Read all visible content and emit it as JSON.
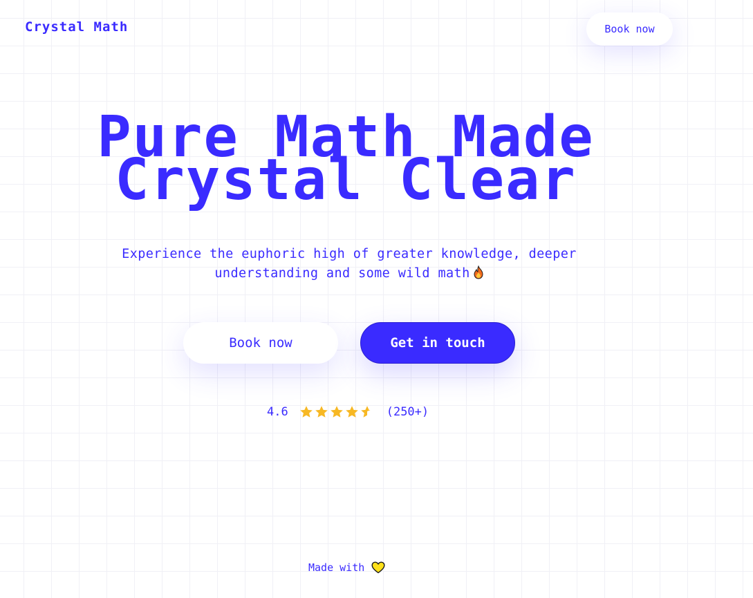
{
  "header": {
    "logo": "Crystal Math",
    "book_label": "Book now"
  },
  "hero": {
    "title_line1": "Pure Math Made",
    "title_line2": "Crystal Clear",
    "subtitle_line1": "Experience the euphoric high of greater knowledge, deeper",
    "subtitle_line2": "understanding and some wild math",
    "subtitle_icon": "fire-icon"
  },
  "actions": {
    "book_label": "Book now",
    "contact_label": "Get in touch"
  },
  "rating": {
    "score": "4.6",
    "stars": 4.6,
    "max_stars": 5,
    "count": "(250+)"
  },
  "footer": {
    "made_with": "Made with",
    "icon": "heart-icon"
  },
  "colors": {
    "accent": "#3a2bff",
    "star": "#f7b824",
    "heart": "#ffe11a",
    "background": "#ffffff"
  }
}
